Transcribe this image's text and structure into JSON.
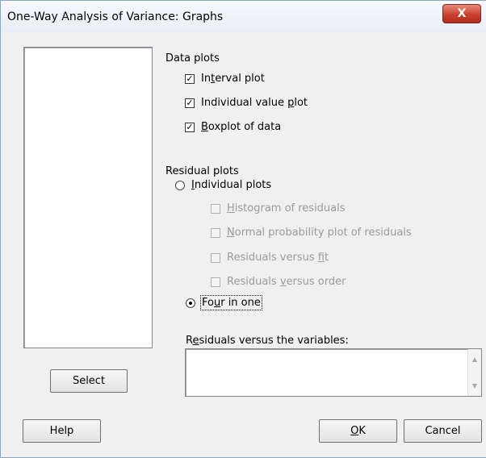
{
  "window": {
    "title": "One-Way Analysis of Variance: Graphs",
    "close_glyph": "X"
  },
  "data_plots": {
    "label": "Data plots",
    "items": [
      {
        "pre": "In",
        "u": "t",
        "post": "erval plot",
        "checked": true
      },
      {
        "pre": "Individual value ",
        "u": "p",
        "post": "lot",
        "checked": true
      },
      {
        "pre": "",
        "u": "B",
        "post": "oxplot of data",
        "checked": true
      }
    ]
  },
  "residual_plots": {
    "label": "Residual plots",
    "individual": {
      "pre": "",
      "u": "I",
      "post": "ndividual plots",
      "selected": false
    },
    "sub_items": [
      {
        "pre": "",
        "u": "H",
        "post": "istogram of residuals",
        "checked": false
      },
      {
        "pre": "",
        "u": "N",
        "post": "ormal probability plot of residuals",
        "checked": false
      },
      {
        "pre": "Residuals versus ",
        "u": "f",
        "post": "it",
        "checked": false
      },
      {
        "pre": "Residuals ",
        "u": "v",
        "post": "ersus order",
        "checked": false
      }
    ],
    "four_in_one": {
      "pre": "Fo",
      "u": "u",
      "post": "r in one",
      "selected": true
    }
  },
  "residuals_vs_vars": {
    "pre": "R",
    "u": "e",
    "post": "siduals versus the variables:",
    "value": ""
  },
  "buttons": {
    "select": "Select",
    "help": "Help",
    "ok_u": "O",
    "ok_post": "K",
    "cancel": "Cancel"
  }
}
